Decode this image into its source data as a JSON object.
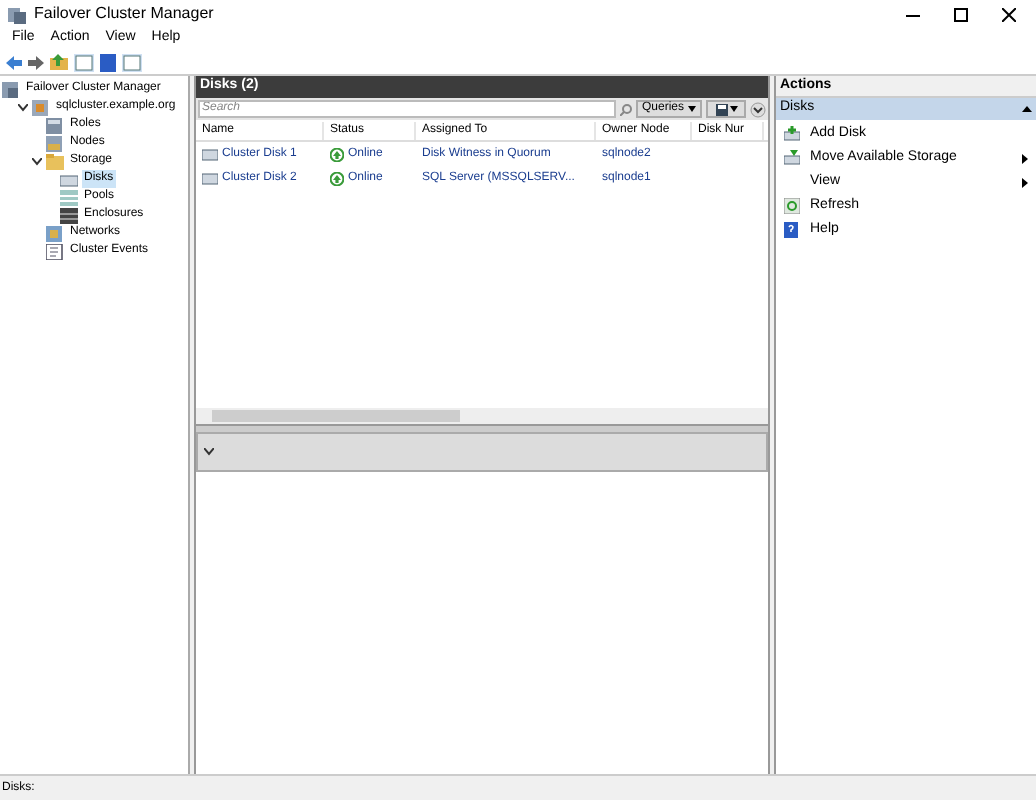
{
  "window": {
    "title": "Failover Cluster Manager"
  },
  "menu": [
    "File",
    "Action",
    "View",
    "Help"
  ],
  "tree": [
    {
      "label": "Failover Cluster Manager",
      "selected": false,
      "expanded": true,
      "children": [
        {
          "label": "sqlcluster.example.org",
          "selected": false,
          "expanded": true,
          "children": [
            {
              "label": "Roles",
              "selected": false
            },
            {
              "label": "Nodes",
              "selected": false
            },
            {
              "label": "Storage",
              "selected": false,
              "expanded": true,
              "children": [
                {
                  "label": "Disks",
                  "selected": true
                },
                {
                  "label": "Pools",
                  "selected": false
                },
                {
                  "label": "Enclosures",
                  "selected": false
                }
              ]
            },
            {
              "label": "Networks",
              "selected": false
            },
            {
              "label": "Cluster Events",
              "selected": false
            }
          ]
        }
      ]
    }
  ],
  "center": {
    "title": "Disks (2)",
    "search": {
      "placeholder": "Search"
    },
    "queries_button": "Queries",
    "table": {
      "columns": [
        "Name",
        "Status",
        "Assigned To",
        "Owner Node",
        "Disk Nur"
      ],
      "rows": [
        [
          "Cluster Disk 1",
          "Online",
          "Disk Witness in Quorum",
          "sqlnode2"
        ],
        [
          "Cluster Disk 2",
          "Online",
          "SQL Server (MSSQLSERV...",
          "sqlnode1"
        ]
      ]
    }
  },
  "actions": {
    "title": "Actions",
    "section": "Disks",
    "items": [
      {
        "label": "Add Disk",
        "submenu": false
      },
      {
        "label": "Move Available Storage",
        "submenu": true
      },
      {
        "label": "View",
        "submenu": true
      },
      {
        "label": "Refresh",
        "submenu": false
      },
      {
        "label": "Help",
        "submenu": false
      }
    ]
  },
  "status_bar": "Disks:"
}
